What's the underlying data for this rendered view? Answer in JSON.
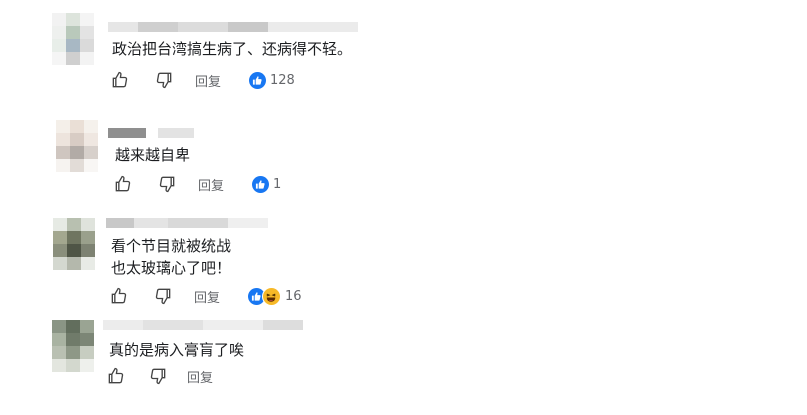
{
  "comments": [
    {
      "text_lines": [
        "政治把台湾搞生病了、还病得不轻。"
      ],
      "reply_label": "回复",
      "reactions": [
        "like"
      ],
      "reaction_count": "128"
    },
    {
      "text_lines": [
        "越来越自卑"
      ],
      "reply_label": "回复",
      "reactions": [
        "like"
      ],
      "reaction_count": "1"
    },
    {
      "text_lines": [
        "看个节目就被统战",
        "也太玻璃心了吧！"
      ],
      "reply_label": "回复",
      "reactions": [
        "like",
        "haha"
      ],
      "reaction_count": "16"
    },
    {
      "text_lines": [
        "真的是病入膏肓了唉"
      ],
      "reply_label": "回复",
      "reactions": [],
      "reaction_count": ""
    }
  ],
  "colors": {
    "like_blue": "#1877f2",
    "haha_yellow": "#f7b928",
    "secondary_text": "#65676b"
  },
  "icons": [
    "thumb-up-outline-icon",
    "thumb-down-outline-icon",
    "like-reaction-icon",
    "haha-reaction-icon"
  ]
}
